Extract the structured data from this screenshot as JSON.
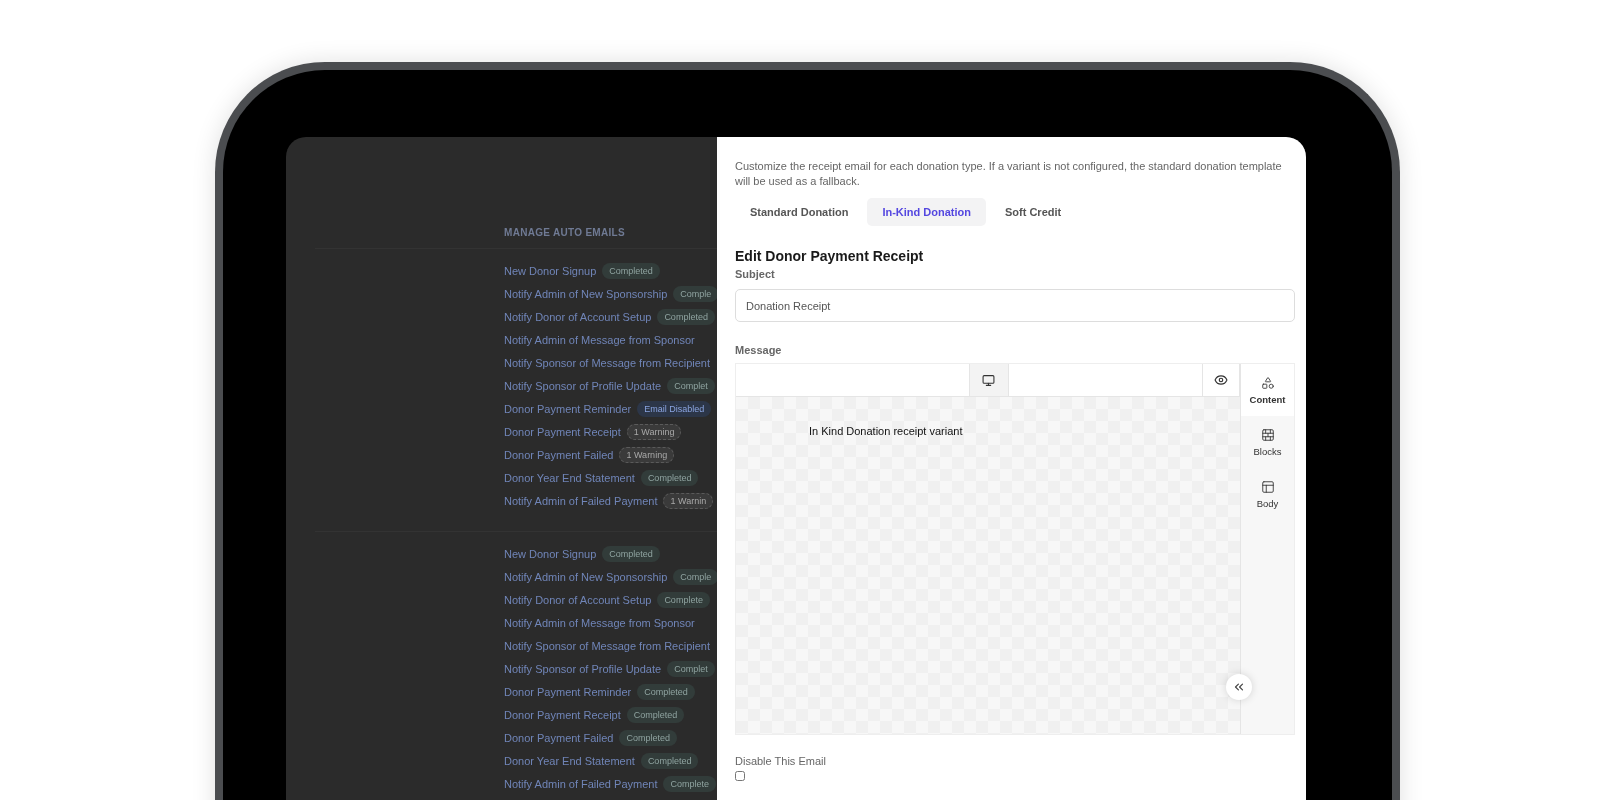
{
  "background_lists": [
    {
      "title": "MANAGE AUTO EMAILS",
      "items": [
        {
          "name": "New Donor Signup",
          "badge": {
            "text": "Completed",
            "kind": "completed"
          }
        },
        {
          "name": "Notify Admin of New Sponsorship",
          "badge": {
            "text": "Comple",
            "kind": "completed"
          }
        },
        {
          "name": "Notify Donor of Account Setup",
          "badge": {
            "text": "Completed",
            "kind": "completed"
          }
        },
        {
          "name": "Notify Admin of Message from Sponsor"
        },
        {
          "name": "Notify Sponsor of Message from Recipient"
        },
        {
          "name": "Notify Sponsor of Profile Update",
          "badge": {
            "text": "Complet",
            "kind": "completed"
          }
        },
        {
          "name": "Donor Payment Reminder",
          "badge": {
            "text": "Email Disabled",
            "kind": "disabled"
          }
        },
        {
          "name": "Donor Payment Receipt",
          "badge": {
            "text": "1 Warning",
            "kind": "warning"
          }
        },
        {
          "name": "Donor Payment Failed",
          "badge": {
            "text": "1 Warning",
            "kind": "warning"
          }
        },
        {
          "name": "Donor Year End Statement",
          "badge": {
            "text": "Completed",
            "kind": "completed"
          }
        },
        {
          "name": "Notify Admin of Failed Payment",
          "badge": {
            "text": "1 Warnin",
            "kind": "warning"
          }
        }
      ]
    },
    {
      "items": [
        {
          "name": "New Donor Signup",
          "badge": {
            "text": "Completed",
            "kind": "completed"
          }
        },
        {
          "name": "Notify Admin of New Sponsorship",
          "badge": {
            "text": "Comple",
            "kind": "completed"
          }
        },
        {
          "name": "Notify Donor of Account Setup",
          "badge": {
            "text": "Complete",
            "kind": "completed"
          }
        },
        {
          "name": "Notify Admin of Message from Sponsor"
        },
        {
          "name": "Notify Sponsor of Message from Recipient"
        },
        {
          "name": "Notify Sponsor of Profile Update",
          "badge": {
            "text": "Complet",
            "kind": "completed"
          }
        },
        {
          "name": "Donor Payment Reminder",
          "badge": {
            "text": "Completed",
            "kind": "completed"
          }
        },
        {
          "name": "Donor Payment Receipt",
          "badge": {
            "text": "Completed",
            "kind": "completed"
          }
        },
        {
          "name": "Donor Payment Failed",
          "badge": {
            "text": "Completed",
            "kind": "completed"
          }
        },
        {
          "name": "Donor Year End Statement",
          "badge": {
            "text": "Completed",
            "kind": "completed"
          }
        },
        {
          "name": "Notify Admin of Failed Payment",
          "badge": {
            "text": "Complete",
            "kind": "completed"
          }
        }
      ]
    }
  ],
  "panel": {
    "description": "Customize the receipt email for each donation type. If a variant is not configured, the standard donation template will be used as a fallback.",
    "tabs": [
      {
        "label": "Standard Donation",
        "selected": false
      },
      {
        "label": "In-Kind Donation",
        "selected": true
      },
      {
        "label": "Soft Credit",
        "selected": false
      }
    ],
    "heading": "Edit Donor Payment Receipt",
    "subject": {
      "label": "Subject",
      "value": "Donation Receipt"
    },
    "message": {
      "label": "Message",
      "preview_text": "In Kind Donation receipt variant",
      "sidebar": [
        {
          "label": "Content",
          "kind": "content",
          "selected": true
        },
        {
          "label": "Blocks",
          "kind": "blocks",
          "selected": false
        },
        {
          "label": "Body",
          "kind": "body",
          "selected": false
        }
      ]
    },
    "disable": {
      "label": "Disable This Email",
      "checked": false
    }
  }
}
